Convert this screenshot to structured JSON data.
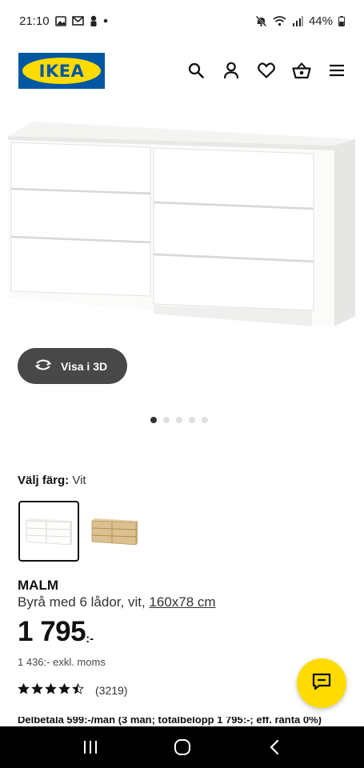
{
  "status_bar": {
    "time": "21:10",
    "battery": "44%",
    "left_icons": [
      "image-icon",
      "mail-icon",
      "person-icon",
      "dot-icon"
    ],
    "right_icons": [
      "mute-icon",
      "wifi-icon",
      "signal-icon",
      "battery-icon"
    ]
  },
  "header": {
    "logo_text": "IKEA",
    "icons": [
      "search-icon",
      "profile-icon",
      "heart-icon",
      "basket-icon",
      "menu-icon"
    ]
  },
  "gallery": {
    "view_3d_label": "Visa i 3D",
    "dots_total": 5,
    "active_index": 0
  },
  "color_picker": {
    "label": "Välj färg:",
    "selected_value": "Vit",
    "options": [
      "white",
      "white-stained-oak"
    ]
  },
  "product": {
    "name": "MALM",
    "description": "Byrå med 6 lådor, vit,",
    "size_link": "160x78 cm",
    "price": "1 795",
    "price_suffix": ":-",
    "price_excl_vat": "1 436:- exkl. moms",
    "rating_stars": 4.5,
    "review_count": "(3219)",
    "installment_text": "Delbetala 599:-/mån (3 mån; totalbelopp 1 795:-; eff. ränta 0%)"
  },
  "colors": {
    "ikea_blue": "#0058a3",
    "ikea_yellow": "#ffdb00",
    "dark_button": "#484848"
  }
}
